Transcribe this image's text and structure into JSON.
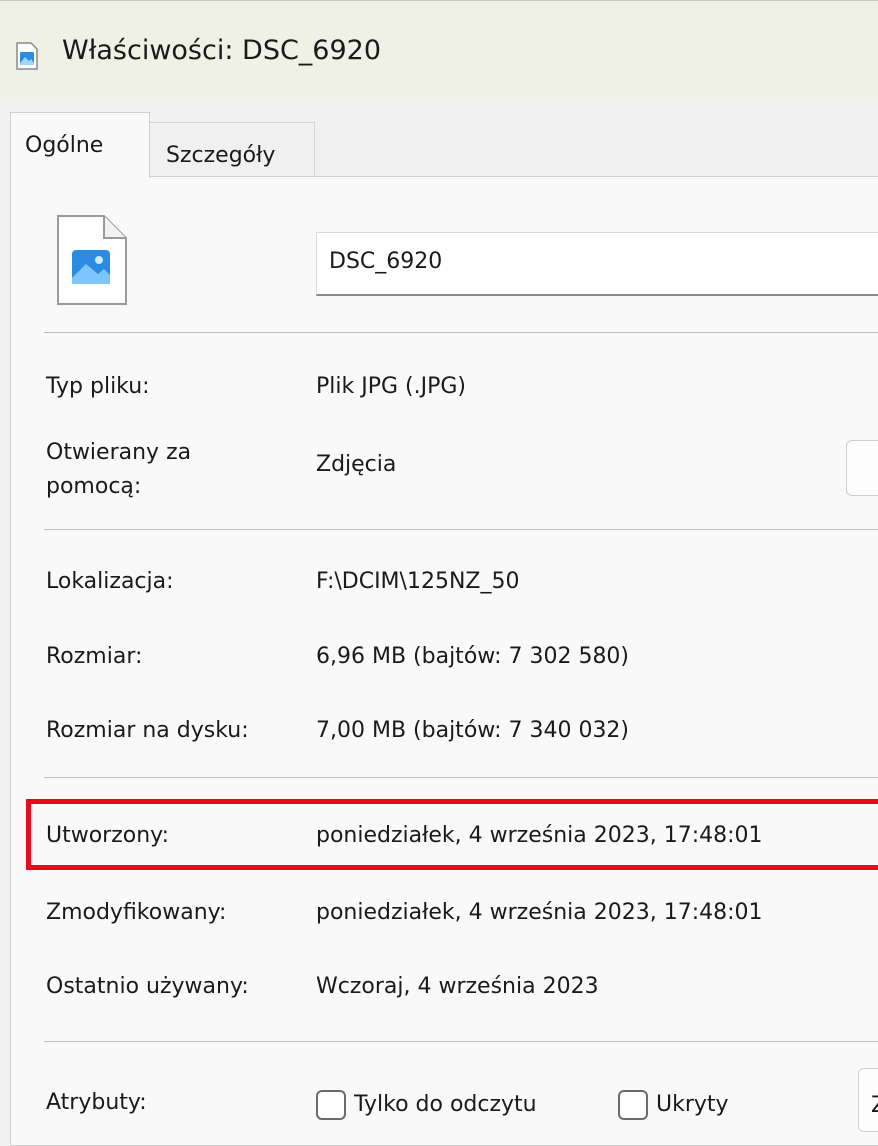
{
  "window": {
    "title": "Właściwości: DSC_6920"
  },
  "tabs": [
    {
      "label": "Ogólne",
      "active": true
    },
    {
      "label": "Szczegóły",
      "active": false
    }
  ],
  "file": {
    "name": "DSC_6920",
    "icon": "image-file-icon"
  },
  "properties": {
    "type": {
      "label": "Typ pliku:",
      "value": "Plik JPG (.JPG)"
    },
    "opens_with": {
      "label": "Otwierany za pomocą:",
      "value": "Zdjęcia"
    },
    "location": {
      "label": "Lokalizacja:",
      "value": "F:\\DCIM\\125NZ_50"
    },
    "size": {
      "label": "Rozmiar:",
      "value": "6,96 MB (bajtów: 7 302 580)"
    },
    "size_on_disk": {
      "label": "Rozmiar na dysku:",
      "value": "7,00 MB (bajtów: 7 340 032)"
    },
    "created": {
      "label": "Utworzony:",
      "value": "poniedziałek, 4 września 2023, 17:48:01"
    },
    "modified": {
      "label": "Zmodyfikowany:",
      "value": "poniedziałek, 4 września 2023, 17:48:01"
    },
    "accessed": {
      "label": "Ostatnio używany:",
      "value": "Wczoraj, 4 września 2023"
    }
  },
  "attributes": {
    "label": "Atrybuty:",
    "readonly_label": "Tylko do odczytu",
    "hidden_label": "Ukryty",
    "advanced_button_partial": "Z"
  },
  "colors": {
    "highlight": "#e8091a",
    "titlebar": "#eef1e4",
    "icon_blue": "#2b8be3"
  }
}
